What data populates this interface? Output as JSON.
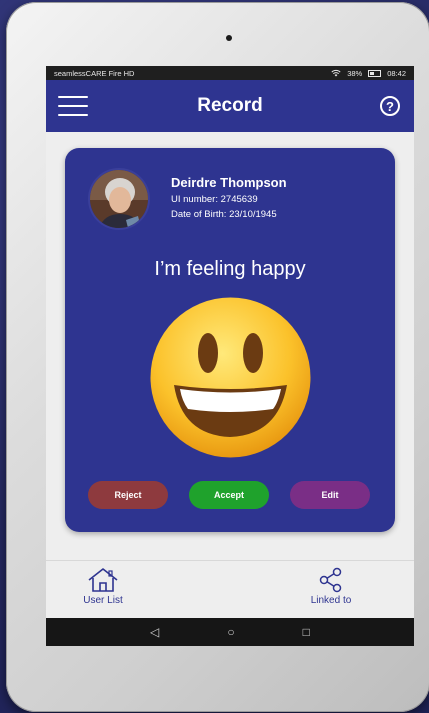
{
  "status_bar": {
    "left_text": "seamlessCARE Fire HD",
    "battery": "38%",
    "battery_level": 0.38,
    "time": "08:42"
  },
  "app_bar": {
    "title": "Record",
    "menu_icon": "hamburger-menu-icon",
    "help_icon": "help-icon",
    "help_glyph": "?"
  },
  "record": {
    "name": "Deirdre Thompson",
    "ui_number": "UI number: 2745639",
    "dob": "Date of Birth: 23/10/1945",
    "feeling": "I’m feeling happy",
    "emoji": "grinning-face-icon"
  },
  "actions": {
    "reject": "Reject",
    "accept": "Accept",
    "edit": "Edit"
  },
  "bottom_nav": {
    "user_list": "User List",
    "linked_to": "Linked to"
  },
  "android_nav": {
    "back": "◁",
    "home": "○",
    "recents": "□"
  },
  "colors": {
    "primary": "#2e3490",
    "reject": "#8e3a3e",
    "accept": "#1fa22c",
    "edit": "#7a2e86"
  }
}
